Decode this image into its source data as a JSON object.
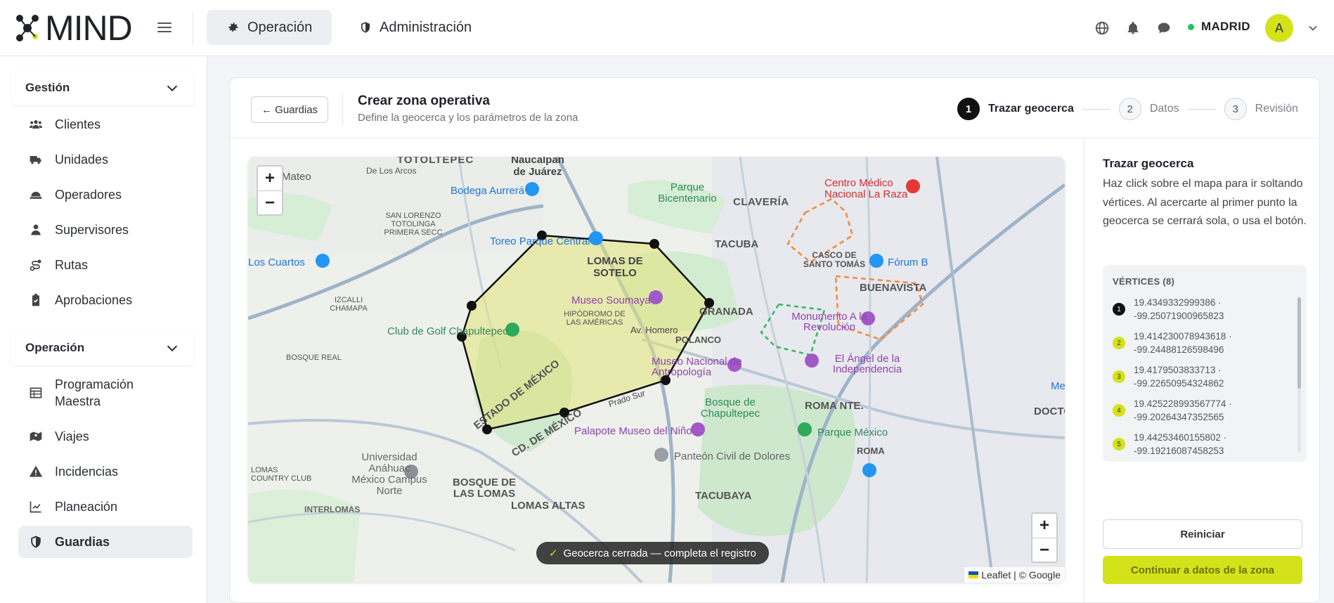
{
  "app": {
    "logo_text": "MIND"
  },
  "topbar": {
    "tabs": [
      {
        "label": "Operación",
        "icon": "gear-icon",
        "active": true
      },
      {
        "label": "Administración",
        "icon": "shield-icon",
        "active": false
      }
    ],
    "city": "MADRID",
    "city_status_color": "#22c55e",
    "avatar_initial": "A"
  },
  "sidebar": {
    "sections": [
      {
        "title": "Gestión",
        "items": [
          "Clientes",
          "Unidades",
          "Operadores",
          "Supervisores",
          "Rutas",
          "Aprobaciones"
        ]
      },
      {
        "title": "Operación",
        "items": [
          "Programación Maestra",
          "Viajes",
          "Incidencias",
          "Planeación",
          "Guardias"
        ]
      }
    ],
    "active_item": "Guardias"
  },
  "header": {
    "back_label": "← Guardias",
    "title": "Crear zona operativa",
    "subtitle": "Define la geocerca y los parámetros de la zona",
    "steps": [
      {
        "num": "1",
        "label": "Trazar geocerca",
        "active": true
      },
      {
        "num": "2",
        "label": "Datos",
        "active": false
      },
      {
        "num": "3",
        "label": "Revisión",
        "active": false
      }
    ]
  },
  "map": {
    "zoom_in": "+",
    "zoom_out": "−",
    "toast_check": "✓",
    "toast": "Geocerca cerrada — completa el registro",
    "attribution": "Leaflet | © Google",
    "labels": [
      "TOTOLTEPEC",
      "Naucalpan de Juárez",
      "De Los Arcos",
      "Mateo",
      "Bodega Aurrerá",
      "SAN LORENZO TOTOLINGA PRIMERA SECC",
      "Toreo Parque Central",
      "LOMAS DE SOTELO",
      "Museo Soumaya",
      "HIPÓDROMO DE LAS AMÉRICAS",
      "Av. Homero",
      "POLANCO",
      "Club de Golf Chapultepec",
      "Museo Nacional de Antropología",
      "Bosque de Chapultepec",
      "Palapote Museo del Niño",
      "Panteón Civil de Dolores",
      "ESTADO DE MÉXICO",
      "CD. DE MÉXICO",
      "Prado Sur",
      "IZCALLI CHAMAPA",
      "BOSQUE REAL",
      "Universidad Anáhuac México Campus Norte",
      "LOMAS COUNTRY CLUB",
      "BOSQUE DE LAS LOMAS",
      "LOMAS ALTAS",
      "INTERLOMAS",
      "TACUBAYA",
      "Parque Bicentenario",
      "CLAVERÍA",
      "Centro Médico Nacional La Raza",
      "TACUBA",
      "CASCO DE SANTO TOMÁS",
      "Fórum B",
      "BUENAVISTA",
      "GRANADA",
      "Monumento A la Revolución",
      "El Ángel de la Independencia",
      "ROMA NTE.",
      "DOCTOR",
      "Parque México",
      "ROMA",
      "Los Cuartos",
      "Me"
    ]
  },
  "panel": {
    "title": "Trazar geocerca",
    "description": "Haz click sobre el mapa para ir soltando vértices. Al acercarte al primer punto la geocerca se cerrará sola, o usa el botón.",
    "vertices_header": "VÉRTICES (8)",
    "vertices": [
      {
        "n": "1",
        "lat": "19.4349332999386 ·",
        "lng": "-99.25071900965823"
      },
      {
        "n": "2",
        "lat": "19.414230078943618 ·",
        "lng": "-99.24488126598496"
      },
      {
        "n": "3",
        "lat": "19.4179503833713 ·",
        "lng": "-99.22650954324862"
      },
      {
        "n": "4",
        "lat": "19.425228993567774 ·",
        "lng": "-99.20264347352565"
      },
      {
        "n": "5",
        "lat": "19.44253460155802 ·",
        "lng": "-99.19216087458253"
      }
    ],
    "reset_label": "Reiniciar",
    "continue_label": "Continuar a datos de la zona"
  },
  "colors": {
    "accent": "#d4e21a",
    "polygon_fill": "#e4e47a",
    "polygon_stroke": "#111111",
    "zone_dash": "#f08a3a",
    "zone_dash_green": "#2eb85c"
  }
}
